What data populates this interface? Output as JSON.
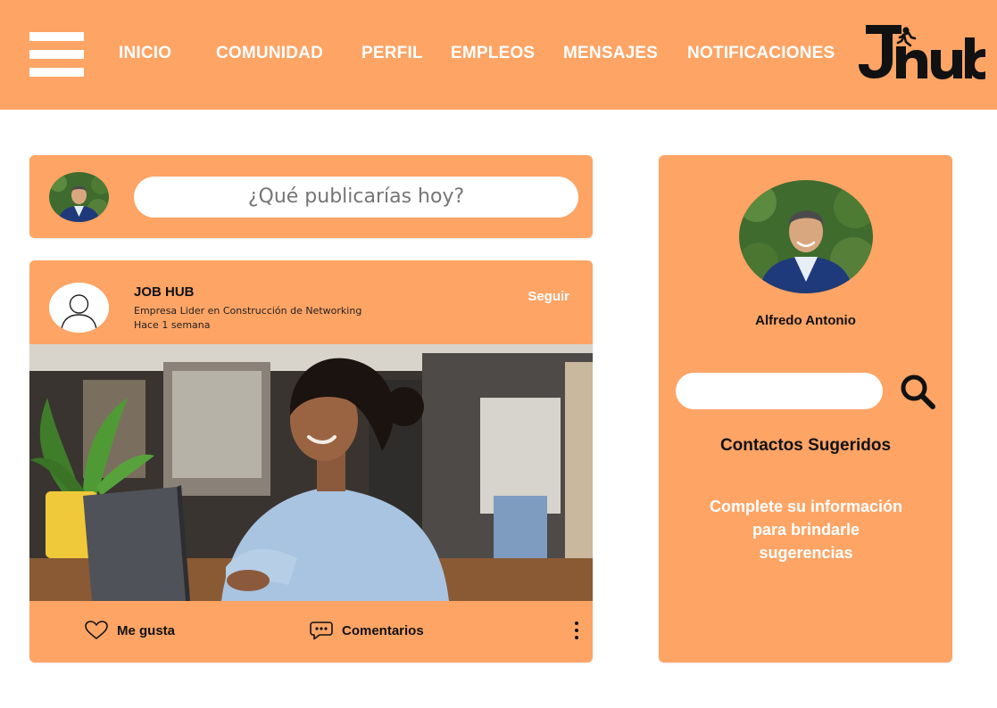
{
  "header": {
    "nav": [
      "INICIO",
      "COMUNIDAD",
      "PERFIL",
      "EMPLEOS",
      "MENSAJES",
      "NOTIFICACIONES"
    ],
    "logo_text": "Jhub",
    "menu_icon": "hamburger-menu-icon"
  },
  "composer": {
    "placeholder": "¿Qué publicarías hoy?",
    "avatar": "user-avatar-photo"
  },
  "post": {
    "author": "JOB HUB",
    "subtitle": "Empresa Lider en Construcción de Networking",
    "time": "Hace 1 semana",
    "follow_label": "Seguir",
    "image": "woman-working-on-laptop-photo",
    "like_label": "Me gusta",
    "comments_label": "Comentarios",
    "icons": [
      "heart-icon",
      "comment-icon",
      "more-vertical-icon"
    ]
  },
  "sidebar": {
    "user_name": "Alfredo Antonio",
    "search_value": "",
    "heading": "Contactos Sugeridos",
    "message": "Complete su información para brindarle sugerencias",
    "search_icon": "search-icon"
  },
  "colors": {
    "brand_orange": "#fea465",
    "white": "#ffffff",
    "text_dark": "#111111"
  }
}
